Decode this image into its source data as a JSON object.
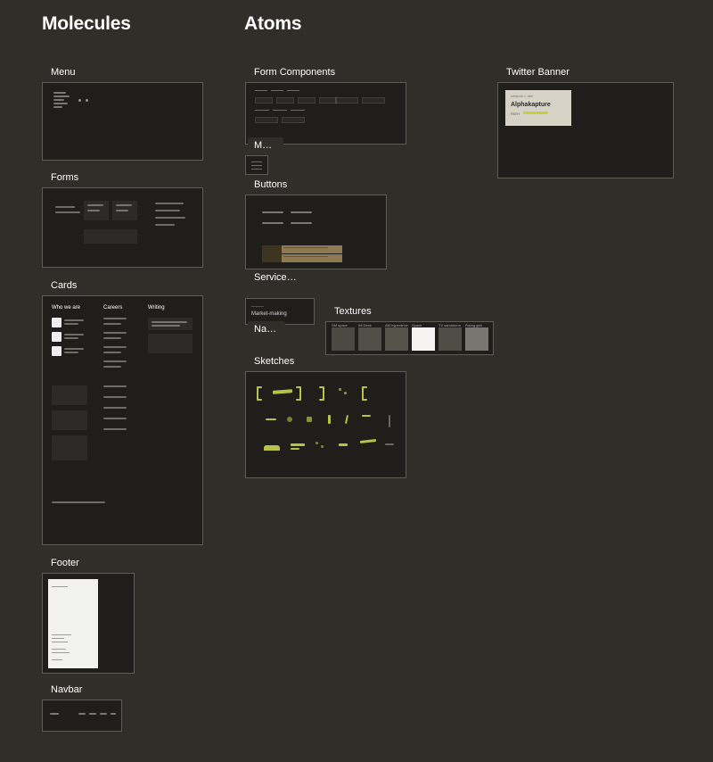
{
  "headings": {
    "molecules": "Molecules",
    "atoms": "Atoms"
  },
  "molecules": {
    "menu": {
      "label": "Menu"
    },
    "forms": {
      "label": "Forms"
    },
    "cards": {
      "label": "Cards",
      "columns": [
        "Who we are",
        "Careers",
        "Writing"
      ]
    },
    "footer": {
      "label": "Footer"
    },
    "navbar": {
      "label": "Navbar"
    }
  },
  "atoms": {
    "form_components": {
      "label": "Form Components"
    },
    "menu": {
      "label": "Men…"
    },
    "buttons": {
      "label": "Buttons"
    },
    "service": {
      "label": "Service R…"
    },
    "navbar": {
      "label": "Navb…",
      "line1": "Market-making"
    },
    "textures": {
      "label": "Textures",
      "swatches": [
        {
          "name": "SM space",
          "color": "#4a4942"
        },
        {
          "name": "IM Deck",
          "color": "#514f47"
        },
        {
          "name": "AM hyperdrive",
          "color": "#55534a"
        },
        {
          "name": "Space",
          "color": "#f5f4f0"
        },
        {
          "name": "TV sandstorm",
          "color": "#4f4d45"
        },
        {
          "name": "Rising grid",
          "color": "#787671"
        }
      ]
    },
    "sketches": {
      "label": "Sketches"
    },
    "twitter": {
      "label": "Twitter Banner",
      "title": "Alphakapture",
      "sub": "network × defi"
    }
  },
  "accent": "#b8c245"
}
